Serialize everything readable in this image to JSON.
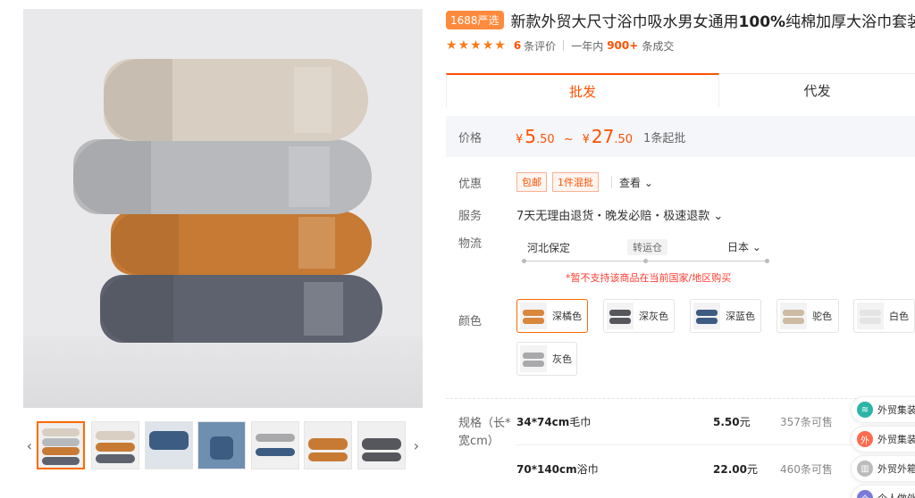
{
  "product": {
    "badge": "1688严选",
    "title_part1": "新款外贸大尺寸浴巾吸水男女通用",
    "title_bold": "100%",
    "title_part2": "纯棉加厚大浴巾套装"
  },
  "rating": {
    "stars": 5,
    "review_count": "6",
    "review_label": "条评价",
    "period_label": "一年内",
    "deals": "900+",
    "deals_label": "条成交"
  },
  "tabs": [
    {
      "label": "批发",
      "active": true
    },
    {
      "label": "代发",
      "active": false
    }
  ],
  "price": {
    "label": "价格",
    "currency": "¥",
    "min_int": "5",
    "min_dec": ".50",
    "sep": "~",
    "max_int": "27",
    "max_dec": ".50",
    "moq": "1条起批"
  },
  "discount": {
    "label": "优惠",
    "tags": [
      "包邮",
      "1件混批"
    ],
    "view": "查看",
    "view_arrow": "⌄"
  },
  "service": {
    "label": "服务",
    "text": "7天无理由退货・晚发必赔・极速退款",
    "arrow": "⌄"
  },
  "logistics": {
    "label": "物流",
    "from": "河北保定",
    "via": "转运仓",
    "to": "日本",
    "to_arrow": "⌄",
    "warning": "*暂不支持该商品在当前国家/地区购买"
  },
  "colors": {
    "label": "颜色",
    "options": [
      {
        "name": "深橘色",
        "swatch": "#d9873c",
        "active": true
      },
      {
        "name": "深灰色",
        "swatch": "#55575c",
        "active": false
      },
      {
        "name": "深蓝色",
        "swatch": "#3d5c82",
        "active": false
      },
      {
        "name": "驼色",
        "swatch": "#cdbba3",
        "active": false
      },
      {
        "name": "白色",
        "swatch": "#efefef",
        "active": false
      },
      {
        "name": "灰色",
        "swatch": "#a9a9ab",
        "active": false
      }
    ]
  },
  "specs": {
    "label": "规格（长*宽cm）",
    "rows": [
      {
        "size": "34*74cm",
        "kind": "毛巾",
        "price": "5.50",
        "unit": "元",
        "stock": "357条可售"
      },
      {
        "size": "70*140cm",
        "kind": "浴巾",
        "price": "22.00",
        "unit": "元",
        "stock": "460条可售"
      }
    ]
  },
  "float_panel": [
    {
      "label": "外贸集装",
      "icon": "ship-icon",
      "color": "#2bb5a8"
    },
    {
      "label": "外贸集装",
      "icon": "外",
      "color": "#ff6a4d"
    },
    {
      "label": "外贸外箱",
      "icon": "box-icon",
      "color": "#bbbbbb"
    },
    {
      "label": "个人做外",
      "icon": "个",
      "color": "#7a7adb"
    }
  ],
  "towel_colors": {
    "beige": "#d8cfc2",
    "gray": "#b9babc",
    "orange": "#c67b36",
    "navy": "#5c616d"
  }
}
